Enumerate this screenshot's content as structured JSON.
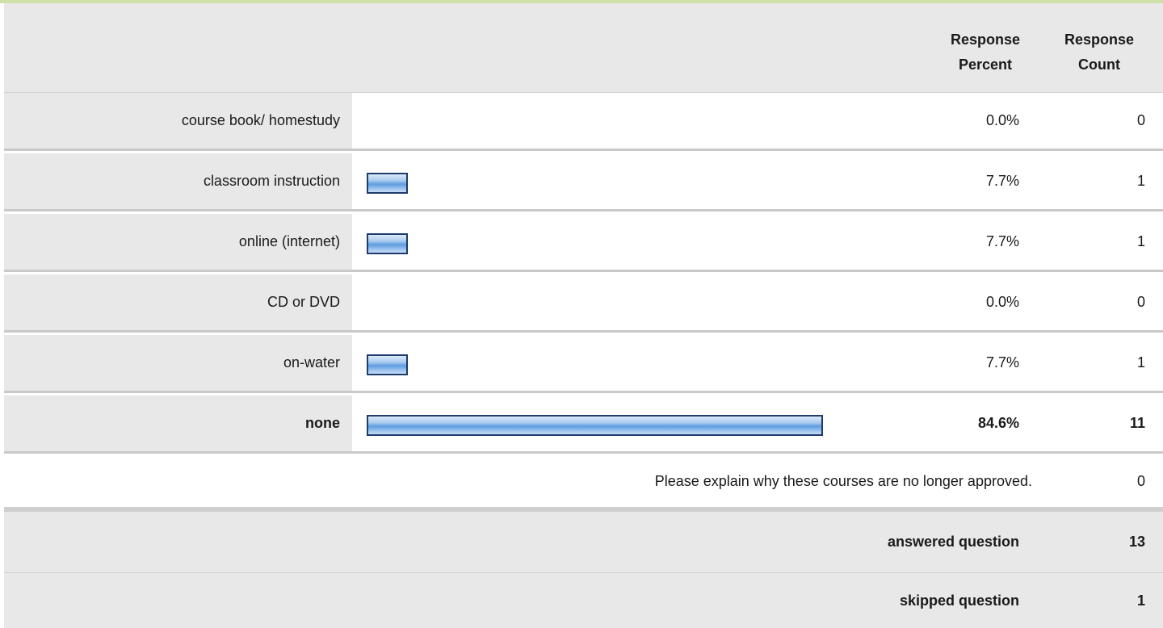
{
  "header": {
    "percent_label": "Response Percent",
    "count_label": "Response Count"
  },
  "chart_data": {
    "type": "bar",
    "orientation": "horizontal",
    "categories": [
      "course book/ homestudy",
      "classroom instruction",
      "online (internet)",
      "CD or DVD",
      "on-water",
      "none"
    ],
    "values": [
      0.0,
      7.7,
      7.7,
      0.0,
      7.7,
      84.6
    ],
    "percent_labels": [
      "0.0%",
      "7.7%",
      "7.7%",
      "0.0%",
      "7.7%",
      "84.6%"
    ],
    "counts": [
      "0",
      "1",
      "1",
      "0",
      "1",
      "11"
    ],
    "highlight_index": 5,
    "xlim": [
      0,
      100
    ],
    "bar_color": "#7fb2e8",
    "bar_border_color": "#1d3b6b"
  },
  "explain": {
    "text": "Please explain why these courses are no longer approved.",
    "count": "0"
  },
  "summary": {
    "answered_label": "answered question",
    "answered_count": "13",
    "skipped_label": "skipped question",
    "skipped_count": "1"
  }
}
